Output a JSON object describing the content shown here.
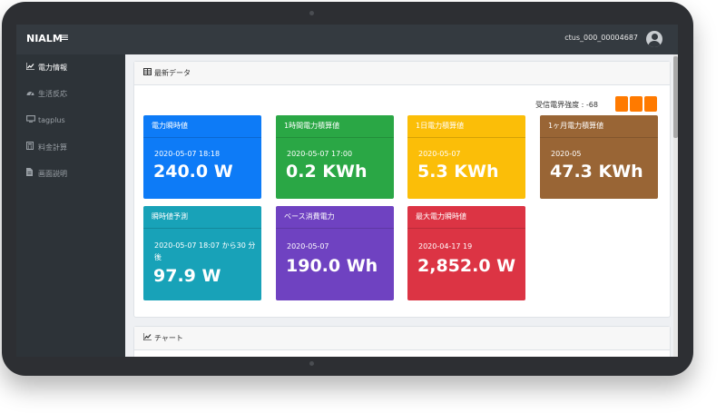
{
  "header": {
    "brand": "NIALM",
    "menu_icon": "hamburger-icon",
    "user": "ctus_000_00004687",
    "avatar_icon": "user-avatar-icon"
  },
  "sidebar": {
    "items": [
      {
        "label": "電力情報",
        "icon": "chart-icon",
        "active": true
      },
      {
        "label": "生活反応",
        "icon": "gauge-icon",
        "active": false
      },
      {
        "label": "tagplus",
        "icon": "monitor-icon",
        "active": false
      },
      {
        "label": "料金計算",
        "icon": "calculator-icon",
        "active": false
      },
      {
        "label": "画面説明",
        "icon": "document-icon",
        "active": false
      }
    ]
  },
  "latest": {
    "title": "最新データ",
    "icon": "table-icon",
    "signal": {
      "label": "受信電界強度 : -68",
      "bars": 3,
      "color": "#ff7a00"
    },
    "tiles": [
      {
        "title": "電力瞬時値",
        "time": "2020-05-07 18:18",
        "value": "240.0 W",
        "color": "#0d7bf7"
      },
      {
        "title": "1時間電力積算値",
        "time": "2020-05-07 17:00",
        "value": "0.2 KWh",
        "color": "#2aa745"
      },
      {
        "title": "1日電力積算値",
        "time": "2020-05-07",
        "value": "5.3 KWh",
        "color": "#fbbe08"
      },
      {
        "title": "1ヶ月電力積算値",
        "time": "2020-05",
        "value": "47.3 KWh",
        "color": "#996535"
      },
      {
        "title": "瞬時値予測",
        "time": "2020-05-07 18:07 から30 分後",
        "value": "97.9 W",
        "color": "#18a2b8"
      },
      {
        "title": "ベース消費電力",
        "time": "2020-05-07",
        "value": "190.0 Wh",
        "color": "#6f42c1"
      },
      {
        "title": "最大電力瞬時値",
        "time": "2020-04-17 19",
        "value": "2,852.0 W",
        "color": "#dc3444"
      }
    ]
  },
  "chart_section": {
    "title": "チャート",
    "icon": "chart-icon"
  }
}
